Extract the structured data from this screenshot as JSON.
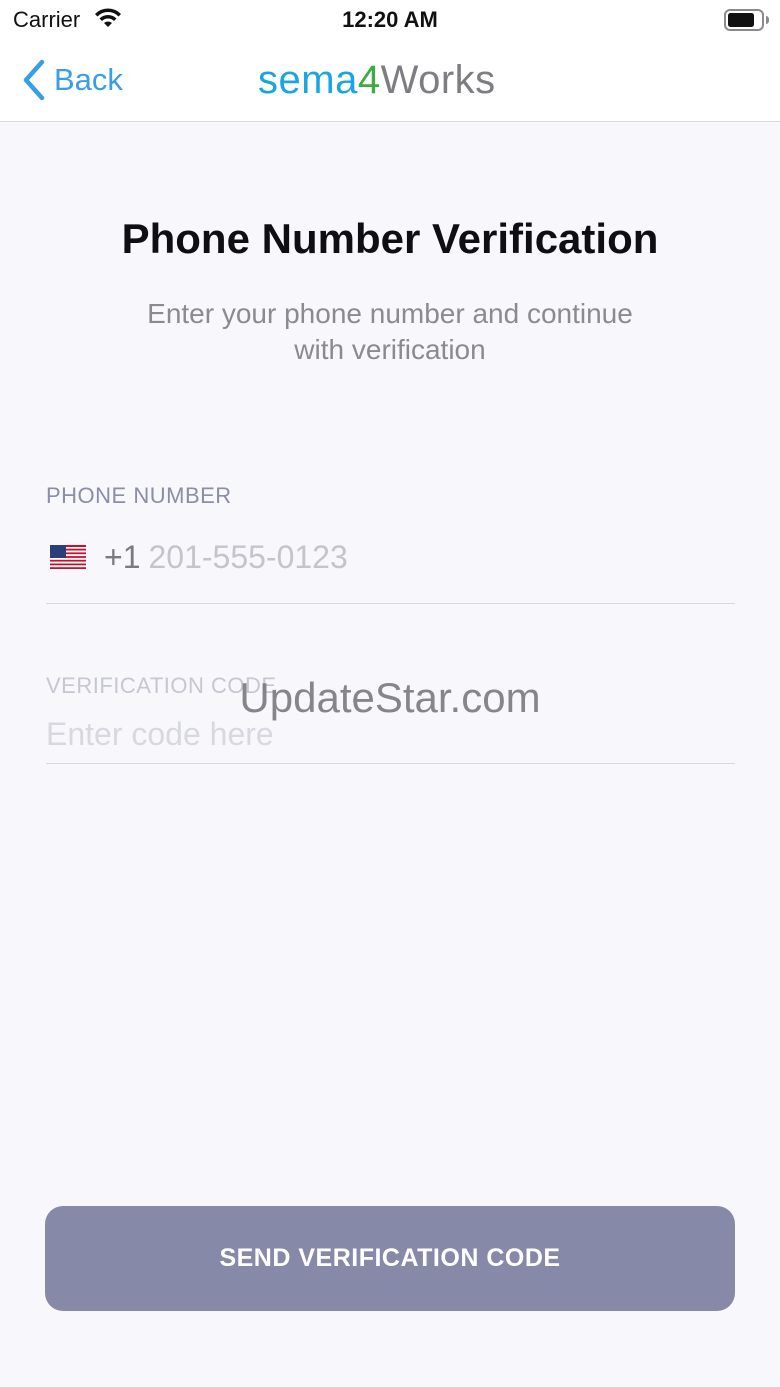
{
  "status_bar": {
    "carrier": "Carrier",
    "time": "12:20 AM",
    "icons": [
      "wifi-icon",
      "battery-icon"
    ]
  },
  "nav": {
    "back_label": "Back",
    "back_icon": "chevron-left-icon",
    "brand": {
      "part_a": "sema",
      "part_b": "4",
      "part_c": "Works"
    }
  },
  "main": {
    "title": "Phone Number Verification",
    "subtitle": "Enter your phone number and continue with verification"
  },
  "phone_field": {
    "label": "PHONE NUMBER",
    "flag_icon": "us-flag-icon",
    "country_code": "+1",
    "value": "",
    "placeholder": "201-555-0123"
  },
  "code_field": {
    "label": "VERIFICATION CODE",
    "value": "",
    "placeholder": "Enter code here"
  },
  "watermark": "UpdateStar.com",
  "send_button": {
    "label": "SEND VERIFICATION CODE"
  },
  "colors": {
    "accent": "#3a9ee4",
    "button": "#8789a8",
    "background": "#f7f7fc",
    "brand_blue": "#19a6e0",
    "brand_green": "#3cab43",
    "brand_gray": "#7d7d82"
  }
}
